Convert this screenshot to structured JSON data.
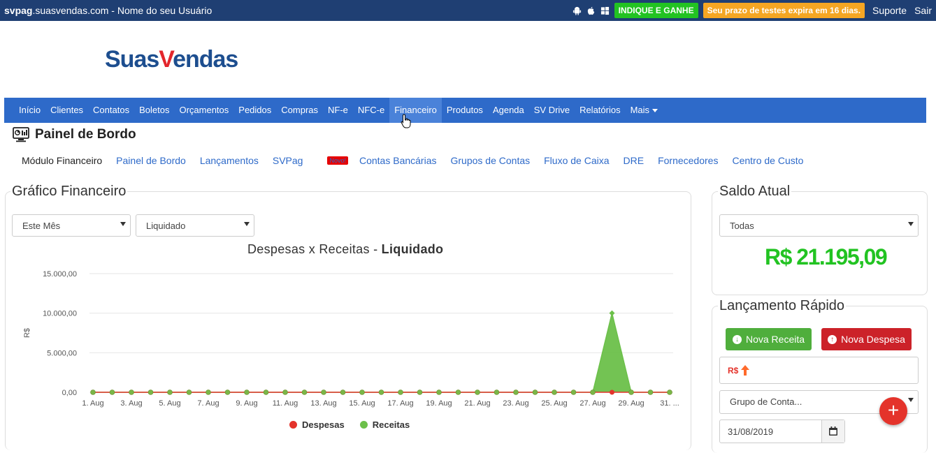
{
  "topbar": {
    "domain_bold": "svpag",
    "domain_rest": ".suasvendas.com",
    "separator": " - ",
    "user": "Nome do seu Usuário",
    "indique": "INDIQUE E GANHE",
    "trial": "Seu prazo de testes expira em 16 dias.",
    "suporte": "Suporte",
    "sair": "Sair"
  },
  "logo": {
    "part1": "Suas",
    "part2": "V",
    "part3": "endas"
  },
  "nav": {
    "items": [
      "Início",
      "Clientes",
      "Contatos",
      "Boletos",
      "Orçamentos",
      "Pedidos",
      "Compras",
      "NF-e",
      "NFC-e",
      "Financeiro",
      "Produtos",
      "Agenda",
      "SV Drive",
      "Relatórios",
      "Mais"
    ],
    "active": "Financeiro"
  },
  "page_title": "Painel de Bordo",
  "subnav": {
    "items": [
      "Módulo Financeiro",
      "Painel de Bordo",
      "Lançamentos",
      "SVPag",
      "Contas Bancárias",
      "Grupos de Contas",
      "Fluxo de Caixa",
      "DRE",
      "Fornecedores",
      "Centro de Custo"
    ],
    "badge": "Novo!"
  },
  "grafico": {
    "title": "Gráfico Financeiro",
    "period_select": "Este Mês",
    "status_select": "Liquidado",
    "chart_title_prefix": "Despesas x Receitas - ",
    "chart_title_bold": "Liquidado"
  },
  "chart_data": {
    "type": "area",
    "title": "Despesas x Receitas - Liquidado",
    "ylabel": "R$",
    "ylim": [
      0,
      15000
    ],
    "y_ticks": [
      "0,00",
      "5.000,00",
      "10.000,00",
      "15.000,00"
    ],
    "x_tick_labels": [
      "1. Aug",
      "3. Aug",
      "5. Aug",
      "7. Aug",
      "9. Aug",
      "11. Aug",
      "13. Aug",
      "15. Aug",
      "17. Aug",
      "19. Aug",
      "21. Aug",
      "23. Aug",
      "25. Aug",
      "27. Aug",
      "29. Aug",
      "31. ..."
    ],
    "x": [
      1,
      2,
      3,
      4,
      5,
      6,
      7,
      8,
      9,
      10,
      11,
      12,
      13,
      14,
      15,
      16,
      17,
      18,
      19,
      20,
      21,
      22,
      23,
      24,
      25,
      26,
      27,
      28,
      29,
      30,
      31
    ],
    "series": [
      {
        "name": "Despesas",
        "color": "#e4332b",
        "values": [
          0,
          0,
          0,
          0,
          0,
          0,
          0,
          0,
          0,
          0,
          0,
          0,
          0,
          0,
          0,
          0,
          0,
          0,
          0,
          0,
          0,
          0,
          0,
          0,
          0,
          0,
          0,
          0,
          0,
          0,
          0
        ]
      },
      {
        "name": "Receitas",
        "color": "#6cc04a",
        "values": [
          0,
          0,
          0,
          0,
          0,
          0,
          0,
          0,
          0,
          0,
          0,
          0,
          0,
          0,
          0,
          0,
          0,
          0,
          0,
          0,
          0,
          0,
          0,
          0,
          0,
          0,
          0,
          10000,
          0,
          0,
          0
        ]
      }
    ],
    "legend": "bottom"
  },
  "saldo": {
    "title": "Saldo Atual",
    "select": "Todas",
    "value": "R$ 21.195,09"
  },
  "quick": {
    "title": "Lançamento Rápido",
    "receita": "Nova Receita",
    "despesa": "Nova Despesa",
    "currency": "R$",
    "grupo_placeholder": "Grupo de Conta...",
    "date": "31/08/2019"
  },
  "colors": {
    "nav": "#2e6ac9",
    "topbar": "#1f3f73",
    "green": "#22c322",
    "red": "#e4332b"
  }
}
